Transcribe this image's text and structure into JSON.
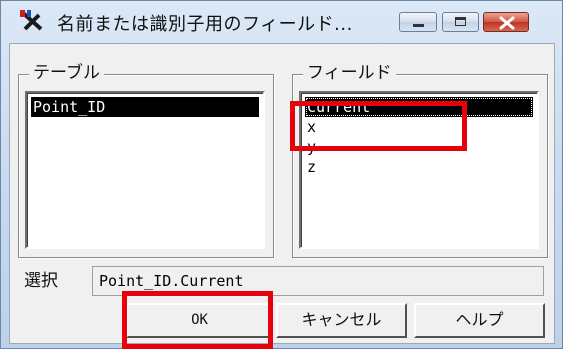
{
  "window": {
    "title": "名前または識別子用のフィールド...",
    "icon": "app-icon-red-blue-x"
  },
  "caption_buttons": {
    "minimize": "minimize-icon",
    "maximize": "maximize-icon",
    "close": "close-icon"
  },
  "table_group": {
    "legend": "テーブル",
    "items": [
      "Point_ID"
    ],
    "selected": "Point_ID"
  },
  "field_group": {
    "legend": "フィールド",
    "items": [
      "Current",
      "x",
      "y",
      "z"
    ],
    "selected": "Current"
  },
  "selection": {
    "label": "選択",
    "value": "Point_ID.Current"
  },
  "buttons": {
    "ok": "OK",
    "cancel": "キャンセル",
    "help": "ヘルプ"
  },
  "colors": {
    "highlight": "#e8000b",
    "selection_bg": "#000000"
  }
}
